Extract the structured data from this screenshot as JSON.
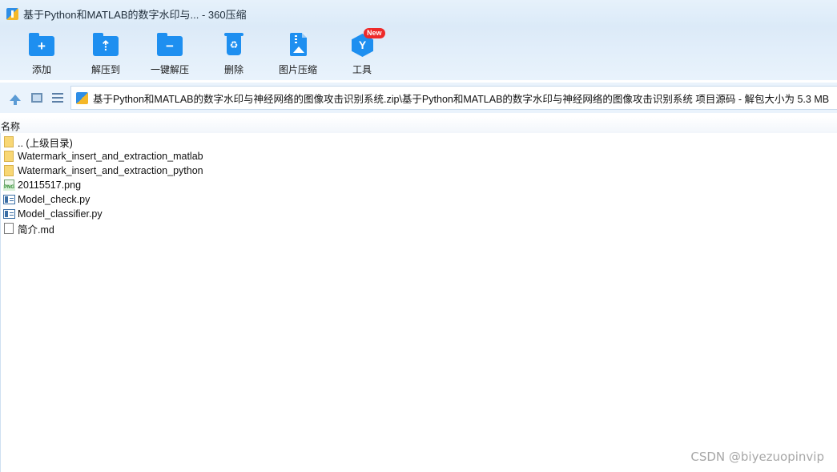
{
  "window": {
    "title": "基于Python和MATLAB的数字水印与... - 360压缩"
  },
  "toolbar": {
    "items": [
      {
        "label": "添加",
        "icon": "add-folder-icon"
      },
      {
        "label": "解压到",
        "icon": "extract-to-icon"
      },
      {
        "label": "一键解压",
        "icon": "one-click-extract-icon"
      },
      {
        "label": "删除",
        "icon": "recycle-bin-icon"
      },
      {
        "label": "图片压缩",
        "icon": "image-compress-icon"
      },
      {
        "label": "工具",
        "icon": "tools-icon",
        "badge": "New"
      }
    ]
  },
  "addressbar": {
    "path": "基于Python和MATLAB的数字水印与神经网络的图像攻击识别系统.zip\\基于Python和MATLAB的数字水印与神经网络的图像攻击识别系统 项目源码 - 解包大小为 5.3 MB"
  },
  "filelist": {
    "column_name": "名称",
    "rows": [
      {
        "name": ".. (上级目录)",
        "type": "parent-folder"
      },
      {
        "name": "Watermark_insert_and_extraction_matlab",
        "type": "folder"
      },
      {
        "name": "Watermark_insert_and_extraction_python",
        "type": "folder"
      },
      {
        "name": "20115517.png",
        "type": "png"
      },
      {
        "name": "Model_check.py",
        "type": "py"
      },
      {
        "name": "Model_classifier.py",
        "type": "py"
      },
      {
        "name": "简介.md",
        "type": "md"
      }
    ]
  },
  "watermark": "CSDN @biyezuopinvip",
  "colors": {
    "accent": "#1e8ff0",
    "badge": "#ee2a2a",
    "toolbar_bg": "#dceaf8"
  }
}
